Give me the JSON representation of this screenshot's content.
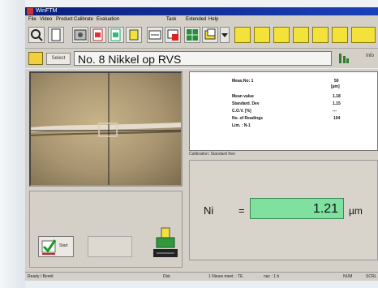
{
  "window": {
    "title": "WinFTM"
  },
  "menu": [
    "File",
    "Video",
    "Product",
    "Calibrate",
    "Evaluation",
    "Task",
    "Extended",
    "Help"
  ],
  "toolbar": {
    "tools": [
      "magnifier-icon",
      "new-doc-icon",
      "photo-tool-icon",
      "red-doc-icon",
      "green-doc-icon",
      "yellow-tool-icon",
      "measure-tool-icon",
      "red-flag-icon",
      "green-grid-icon",
      "stack-icon",
      "dropdown-icon"
    ],
    "yellow_buttons": 7
  },
  "sample": {
    "select_label": "Select",
    "name": "No. 8  Nikkel op RVS",
    "rr_label": "Info"
  },
  "results": {
    "rows": [
      {
        "label": "Meas.No: 1",
        "value": "50"
      },
      {
        "label": "",
        "value": "[µm]"
      },
      {
        "label": "Mean value",
        "value": "1.18"
      },
      {
        "label": "Standard. Dev",
        "value": "1.15"
      },
      {
        "label": "C.O.V. [%]",
        "value": "---"
      },
      {
        "label": "No. of Readings",
        "value": "104"
      },
      {
        "label": "Lim. : N-1",
        "value": ""
      }
    ],
    "calibration_label": "Calibration: Standard free"
  },
  "measurement": {
    "element": "Ni",
    "equals": "=",
    "value": "1.21",
    "unit": "µm"
  },
  "controls": {
    "start_label": "Start"
  },
  "status": [
    "Ready / Bereit",
    "Dist",
    "1  Nieuw  meet. : TE",
    "nac : 1 b",
    "NUM",
    "SCRL"
  ],
  "colors": {
    "title_bar": "#0a1f7a",
    "value_box": "#7fe0a0",
    "ui_gray": "#d4d0c8"
  }
}
